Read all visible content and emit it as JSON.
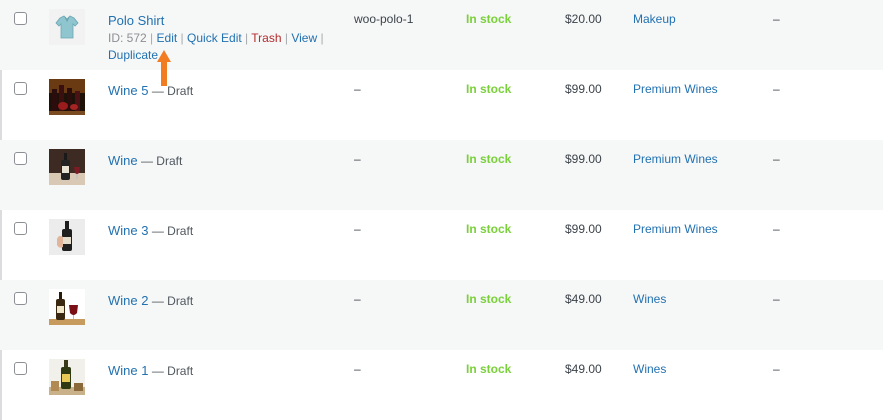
{
  "rows": [
    {
      "name": "Polo Shirt",
      "status": "",
      "sku": "woo-polo-1",
      "stock": "In stock",
      "price": "$20.00",
      "category": "Makeup",
      "tags": "–",
      "row_actions": {
        "id_label": "ID: 572",
        "edit": "Edit",
        "quick_edit": "Quick Edit",
        "trash": "Trash",
        "view": "View",
        "duplicate": "Duplicate",
        "separator": "|"
      },
      "thumb": "polo-shirt-icon"
    },
    {
      "name": "Wine 5",
      "status": "— Draft",
      "sku": "–",
      "stock": "In stock",
      "price": "$99.00",
      "category": "Premium Wines",
      "tags": "–",
      "thumb": "wine-bottles-icon"
    },
    {
      "name": "Wine",
      "status": "— Draft",
      "sku": "–",
      "stock": "In stock",
      "price": "$99.00",
      "category": "Premium Wines",
      "tags": "–",
      "thumb": "wine-bottle-glass-icon"
    },
    {
      "name": "Wine 3",
      "status": "— Draft",
      "sku": "–",
      "stock": "In stock",
      "price": "$99.00",
      "category": "Premium Wines",
      "tags": "–",
      "thumb": "wine-hand-icon"
    },
    {
      "name": "Wine 2",
      "status": "— Draft",
      "sku": "–",
      "stock": "In stock",
      "price": "$49.00",
      "category": "Wines",
      "tags": "–",
      "thumb": "wine-red-glass-icon"
    },
    {
      "name": "Wine 1",
      "status": "— Draft",
      "sku": "–",
      "stock": "In stock",
      "price": "$49.00",
      "category": "Wines",
      "tags": "–",
      "thumb": "wine-box-icon"
    }
  ],
  "colors": {
    "link": "#2271b1",
    "stock": "#7ad03a",
    "trash": "#b32d2e",
    "annotation_arrow": "#f27c22"
  }
}
